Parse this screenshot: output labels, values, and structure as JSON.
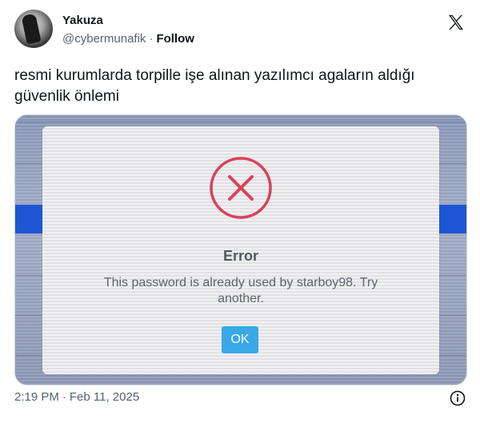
{
  "author": {
    "name": "Yakuza",
    "handle": "@cybermunafik",
    "separator": "·",
    "follow_label": "Follow"
  },
  "icons": {
    "platform": "x-logo-icon",
    "info": "info-icon",
    "error": "error-x-circle-icon"
  },
  "tweet": {
    "text": "resmi kurumlarda torpille işe alınan yazılımcı agaların aldığı güvenlik önlemi"
  },
  "media": {
    "dialog": {
      "title": "Error",
      "message": "This password is already used by starboy98. Try another.",
      "ok_label": "OK"
    }
  },
  "footer": {
    "time": "2:19 PM",
    "separator": "·",
    "date": "Feb 11, 2025"
  },
  "colors": {
    "error_red": "#d9415a",
    "ok_blue": "#38a8e6",
    "text_secondary": "#536471"
  }
}
